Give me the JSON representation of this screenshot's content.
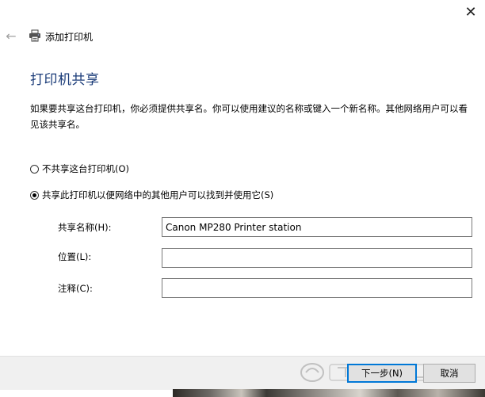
{
  "header": {
    "close_glyph": "✕",
    "back_glyph": "←",
    "title": "添加打印机"
  },
  "main": {
    "heading": "打印机共享",
    "description": "如果要共享这台打印机，你必须提供共享名。你可以使用建议的名称或键入一个新名称。其他网络用户可以看见该共享名。",
    "options": [
      {
        "label": "不共享这台打印机(O)",
        "selected": false
      },
      {
        "label": "共享此打印机以便网络中的其他用户可以找到并使用它(S)",
        "selected": true
      }
    ],
    "fields": {
      "share_name": {
        "label": "共享名称(H):",
        "value": "Canon MP280 Printer station"
      },
      "location": {
        "label": "位置(L):",
        "value": ""
      },
      "comment": {
        "label": "注释(C):",
        "value": ""
      }
    }
  },
  "footer": {
    "next_label": "下一步(N)",
    "cancel_label": "取消"
  },
  "colors": {
    "heading": "#1a3b78",
    "primary_border": "#0078d7",
    "footer_bg": "#f0f0f0"
  },
  "icons": [
    "close-icon",
    "back-arrow-icon",
    "printer-icon",
    "watermark-logo"
  ]
}
